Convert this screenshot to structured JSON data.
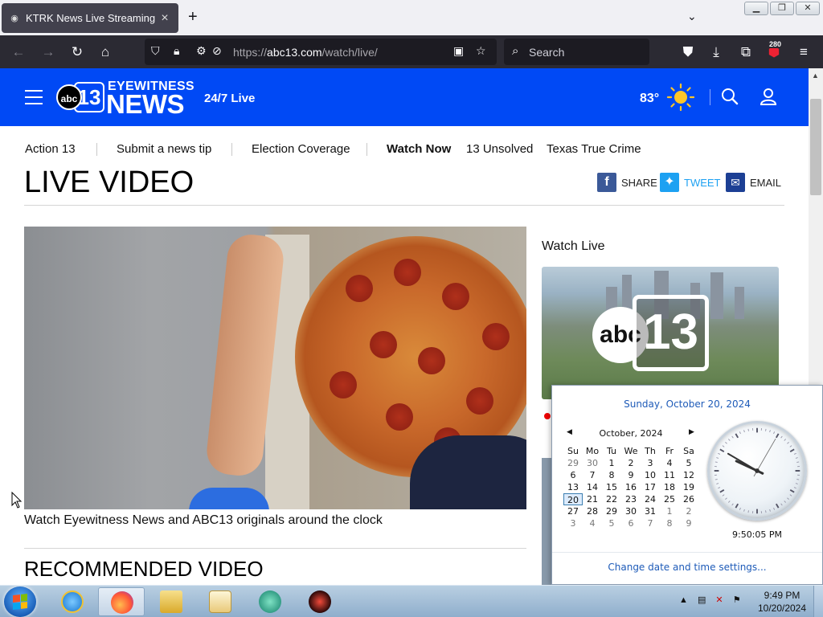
{
  "browser": {
    "tab_title": "KTRK News Live Streaming Vide",
    "new_tab_label": "+",
    "url_domain": "abc13.com",
    "url_prefix": "https://",
    "url_path": "/watch/live/",
    "search_placeholder": "Search",
    "notification_count": "280"
  },
  "site": {
    "logo_abc": "abc",
    "logo_13": "13",
    "logo_eyewitness": "EYEWITNESS",
    "logo_news": "NEWS",
    "live_247": "24/7 Live",
    "temperature": "83°",
    "brand_color": "#0049f5"
  },
  "subnav": {
    "items": [
      "Action 13",
      "Submit a news tip",
      "Election Coverage",
      "Watch Now",
      "13 Unsolved",
      "Texas True Crime"
    ]
  },
  "page": {
    "title": "LIVE VIDEO",
    "share_label": "SHARE",
    "tweet_label": "TWEET",
    "email_label": "EMAIL",
    "video_caption": "Watch Eyewitness News and ABC13 originals around the clock",
    "recommended_heading": "RECOMMENDED VIDEO",
    "watch_live_heading": "Watch Live",
    "thumb_abc": "abc",
    "thumb_13": "13"
  },
  "clock_flyout": {
    "full_date": "Sunday, October 20, 2024",
    "month_label": "October, 2024",
    "weekdays": [
      "Su",
      "Mo",
      "Tu",
      "We",
      "Th",
      "Fr",
      "Sa"
    ],
    "weeks": [
      [
        "29",
        "30",
        "1",
        "2",
        "3",
        "4",
        "5"
      ],
      [
        "6",
        "7",
        "8",
        "9",
        "10",
        "11",
        "12"
      ],
      [
        "13",
        "14",
        "15",
        "16",
        "17",
        "18",
        "19"
      ],
      [
        "20",
        "21",
        "22",
        "23",
        "24",
        "25",
        "26"
      ],
      [
        "27",
        "28",
        "29",
        "30",
        "31",
        "1",
        "2"
      ],
      [
        "3",
        "4",
        "5",
        "6",
        "7",
        "8",
        "9"
      ]
    ],
    "today": "20",
    "time": "9:50:05 PM",
    "settings_link": "Change date and time settings..."
  },
  "taskbar": {
    "time": "9:49 PM",
    "date": "10/20/2024",
    "apps": [
      "internet-explorer",
      "firefox",
      "file-explorer",
      "media-player",
      "app-green",
      "app-red"
    ]
  }
}
